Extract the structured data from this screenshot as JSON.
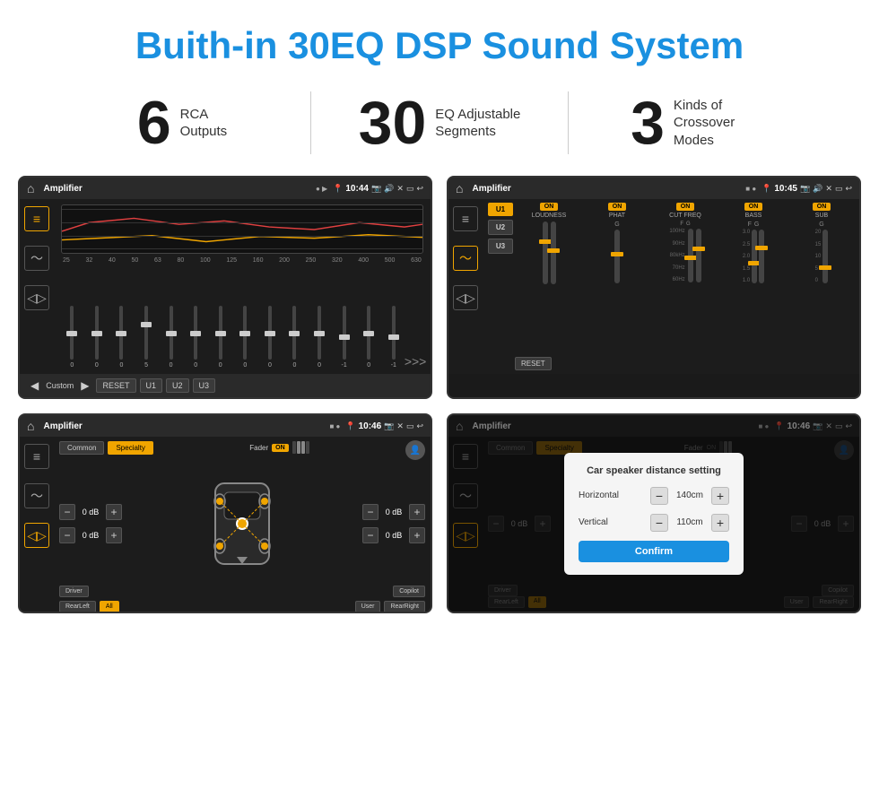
{
  "header": {
    "title": "Buith-in 30EQ DSP Sound System"
  },
  "stats": [
    {
      "number": "6",
      "label": "RCA\nOutputs"
    },
    {
      "number": "30",
      "label": "EQ Adjustable\nSegments"
    },
    {
      "number": "3",
      "label": "Kinds of\nCrossover Modes"
    }
  ],
  "screen1": {
    "title": "Amplifier",
    "time": "10:44",
    "freqs": [
      "25",
      "32",
      "40",
      "50",
      "63",
      "80",
      "100",
      "125",
      "160",
      "200",
      "250",
      "320",
      "400",
      "500",
      "630"
    ],
    "vals": [
      "0",
      "0",
      "0",
      "5",
      "0",
      "0",
      "0",
      "0",
      "0",
      "0",
      "0",
      "-1",
      "0",
      "-1"
    ],
    "preset": "Custom",
    "buttons": [
      "RESET",
      "U1",
      "U2",
      "U3"
    ]
  },
  "screen2": {
    "title": "Amplifier",
    "time": "10:45",
    "channels": [
      "U1",
      "U2",
      "U3"
    ],
    "controls": [
      "LOUDNESS",
      "PHAT",
      "CUT FREQ",
      "BASS",
      "SUB"
    ],
    "resetBtn": "RESET"
  },
  "screen3": {
    "title": "Amplifier",
    "time": "10:46",
    "tabs": [
      "Common",
      "Specialty"
    ],
    "faderLabel": "Fader",
    "faderOn": "ON",
    "volValues": [
      "0 dB",
      "0 dB",
      "0 dB",
      "0 dB"
    ],
    "buttons": [
      "Driver",
      "Copilot",
      "RearLeft",
      "All",
      "User",
      "RearRight"
    ],
    "activeBtn": "All"
  },
  "screen4": {
    "title": "Amplifier",
    "time": "10:46",
    "tabs": [
      "Common",
      "Specialty"
    ],
    "dialog": {
      "title": "Car speaker distance setting",
      "horizontal": {
        "label": "Horizontal",
        "value": "140cm"
      },
      "vertical": {
        "label": "Vertical",
        "value": "110cm"
      },
      "confirmBtn": "Confirm"
    },
    "volValues": [
      "0 dB",
      "0 dB"
    ],
    "buttons": [
      "Driver",
      "Copilot",
      "RearLeft",
      "All",
      "User",
      "RearRight"
    ]
  },
  "colors": {
    "accent": "#1a90e0",
    "gold": "#f0a500",
    "dark": "#1c1c1c",
    "text": "#ffffff"
  }
}
